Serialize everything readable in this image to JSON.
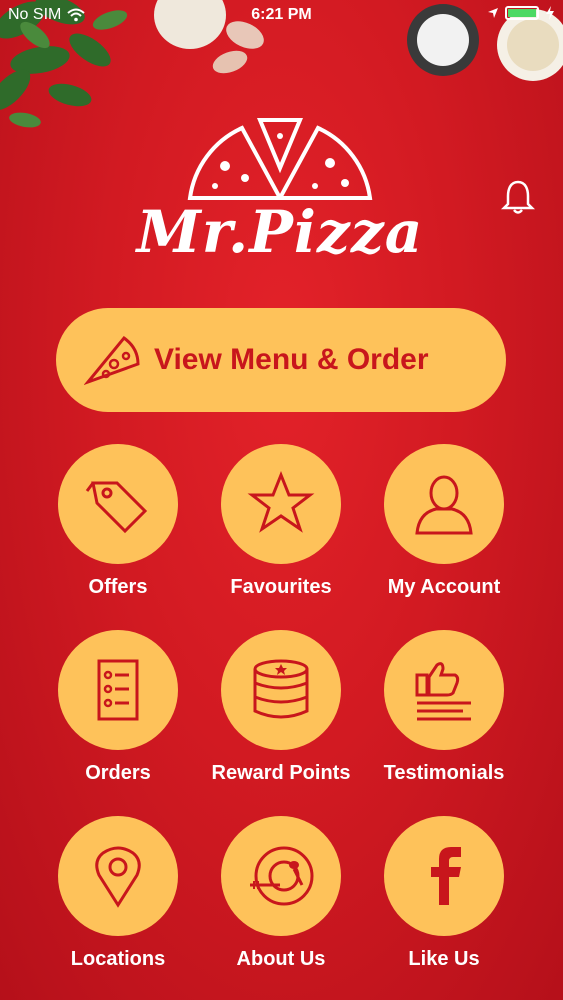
{
  "status_bar": {
    "carrier": "No SIM",
    "time": "6:21 PM"
  },
  "brand": {
    "name": "Mr.Pizza"
  },
  "cta": {
    "label": "View Menu & Order"
  },
  "colors": {
    "background": "#d21a22",
    "accent": "#fec25a",
    "accent_text": "#c8161c"
  },
  "menu": [
    {
      "label": "Offers",
      "icon": "tag-icon"
    },
    {
      "label": "Favourites",
      "icon": "star-icon"
    },
    {
      "label": "My Account",
      "icon": "user-icon"
    },
    {
      "label": "Orders",
      "icon": "list-icon"
    },
    {
      "label": "Reward Points",
      "icon": "coins-icon"
    },
    {
      "label": "Testimonials",
      "icon": "thumbs-up-icon"
    },
    {
      "label": "Locations",
      "icon": "location-pin-icon"
    },
    {
      "label": "About Us",
      "icon": "plate-fork-spoon-icon"
    },
    {
      "label": "Like Us",
      "icon": "facebook-icon"
    }
  ]
}
